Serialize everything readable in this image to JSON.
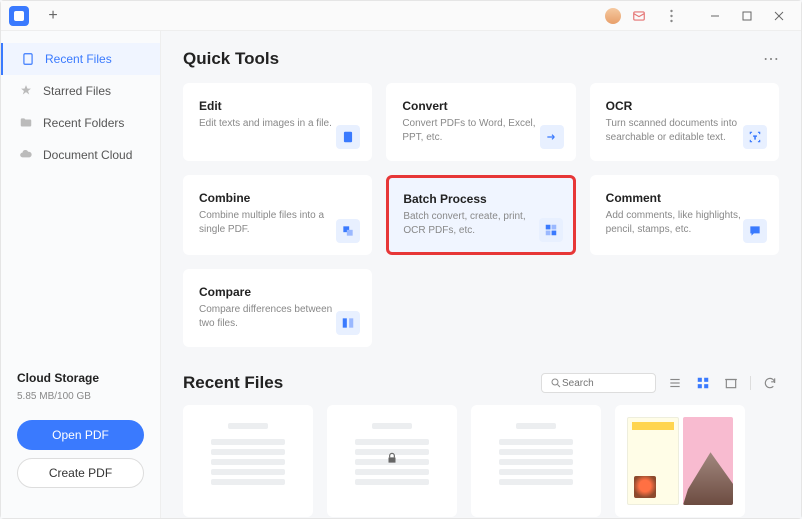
{
  "titlebar": {
    "plus": "+"
  },
  "sidebar": {
    "items": [
      {
        "label": "Recent Files",
        "icon": "recent"
      },
      {
        "label": "Starred Files",
        "icon": "star"
      },
      {
        "label": "Recent Folders",
        "icon": "folder"
      },
      {
        "label": "Document Cloud",
        "icon": "cloud"
      }
    ],
    "cloud": {
      "title": "Cloud Storage",
      "usage": "5.85 MB/100 GB"
    },
    "open_btn": "Open PDF",
    "create_btn": "Create PDF"
  },
  "quick_tools": {
    "title": "Quick Tools",
    "cards": [
      {
        "title": "Edit",
        "desc": "Edit texts and images in a file."
      },
      {
        "title": "Convert",
        "desc": "Convert PDFs to Word, Excel, PPT, etc."
      },
      {
        "title": "OCR",
        "desc": "Turn scanned documents into searchable or editable text."
      },
      {
        "title": "Combine",
        "desc": "Combine multiple files into a single PDF."
      },
      {
        "title": "Batch Process",
        "desc": "Batch convert, create, print, OCR PDFs, etc."
      },
      {
        "title": "Comment",
        "desc": "Add comments, like highlights, pencil, stamps, etc."
      },
      {
        "title": "Compare",
        "desc": "Compare differences between two files."
      }
    ]
  },
  "recent_files": {
    "title": "Recent Files",
    "search_placeholder": "Search"
  }
}
